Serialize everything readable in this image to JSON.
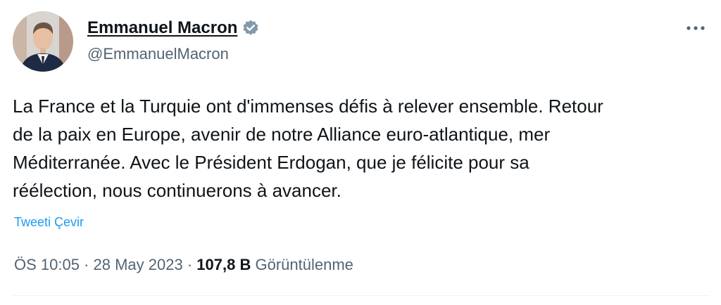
{
  "author": {
    "display_name": "Emmanuel Macron",
    "handle": "@EmmanuelMacron",
    "verified": true,
    "verified_color": "#829aab"
  },
  "tweet": {
    "text": "La France et la Turquie ont d'immenses défis à relever ensemble. Retour\nde la paix en Europe, avenir de notre Alliance euro-atlantique, mer\nMéditerranée. Avec le Président Erdogan, que je félicite pour sa\nréélection, nous continuerons à avancer.",
    "translate_label": "Tweeti Çevir"
  },
  "meta": {
    "time": "ÖS 10:05",
    "separator": " · ",
    "date": "28 May 2023",
    "views_count": "107,8 B",
    "views_label": "Görüntülenme"
  },
  "icons": {
    "verified": "verified-badge-icon",
    "more": "more-horizontal-icon"
  },
  "colors": {
    "link": "#1d9bf0",
    "secondary_text": "#536471",
    "primary_text": "#0f1419"
  }
}
